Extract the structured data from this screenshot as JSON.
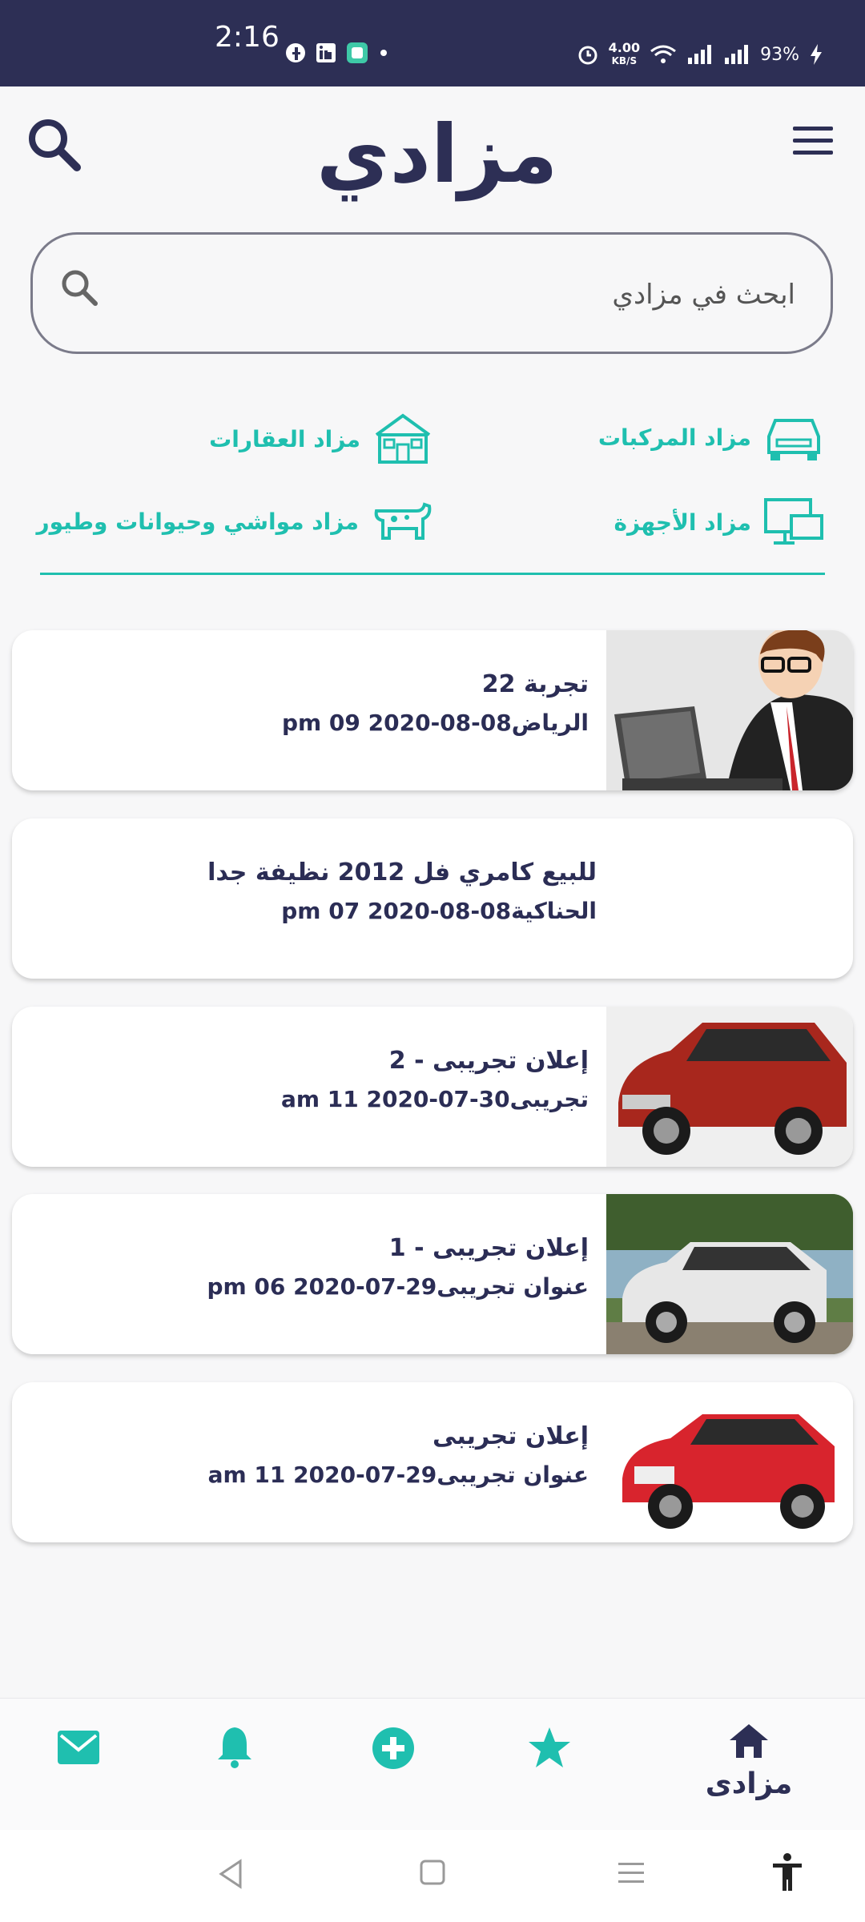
{
  "status_bar": {
    "time": "2:16",
    "speed_value": "4.00",
    "speed_unit": "KB/S",
    "battery": "93%"
  },
  "header": {
    "logo_text": "مزادي"
  },
  "search": {
    "placeholder": "ابحث في مزادي"
  },
  "categories": [
    {
      "label": "مزاد المركبات",
      "icon": "car-icon"
    },
    {
      "label": "مزاد العقارات",
      "icon": "house-icon"
    },
    {
      "label": "مزاد الأجهزة",
      "icon": "devices-icon"
    },
    {
      "label": "مزاد مواشي وحيوانات وطيور",
      "icon": "cow-icon"
    }
  ],
  "listings": [
    {
      "title": "تجربة 22",
      "meta": "الرياض08-08-2020 09 pm",
      "image": "man-laptop-image"
    },
    {
      "title": "للبيع كامري فل 2012 نظيفة جدا",
      "meta": "الحناكية08-08-2020 07 pm",
      "image": ""
    },
    {
      "title": "إعلان تجريبى - 2",
      "meta": "تجريبى30-07-2020 11 am",
      "image": "red-suv-image"
    },
    {
      "title": "إعلان تجريبى - 1",
      "meta": "عنوان تجريبى29-07-2020 06 pm",
      "image": "white-suv-image"
    },
    {
      "title": "إعلان تجريبى",
      "meta": "عنوان تجريبى29-07-2020 11 am",
      "image": "red-jaguar-image"
    }
  ],
  "bottom_nav": {
    "home_label": "مزادى",
    "icons": [
      "mail-icon",
      "bell-icon",
      "add-circle-icon",
      "star-icon",
      "home-icon"
    ]
  },
  "colors": {
    "primary_dark": "#2d2f55",
    "accent_teal": "#1fbfaf"
  }
}
